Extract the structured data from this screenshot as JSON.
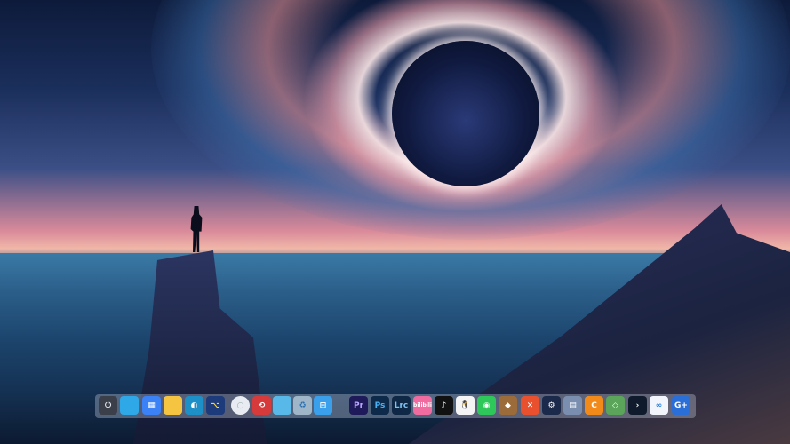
{
  "dock": {
    "items": [
      {
        "name": "power-icon",
        "label": "⏻",
        "bg": "#3a3f4a",
        "color": "#dfe3ea"
      },
      {
        "name": "monitor-icon",
        "label": "",
        "bg": "#2fa8e8"
      },
      {
        "name": "widgets-icon",
        "label": "▦",
        "bg": "#3b82f6"
      },
      {
        "name": "file-explorer-icon",
        "label": "",
        "bg": "#f5c542"
      },
      {
        "name": "edge-browser-icon",
        "label": "◐",
        "bg": "#1e90c8"
      },
      {
        "name": "script-editor-icon",
        "label": "⌥",
        "bg": "#1d3a7a",
        "color": "#f5d442"
      },
      {
        "name": "clock-icon",
        "label": "○",
        "bg": "#e8ecf2",
        "color": "#9aa"
      },
      {
        "name": "red-app-icon",
        "label": "⟲",
        "bg": "#d63a3a"
      },
      {
        "name": "notepad-icon",
        "label": "",
        "bg": "#58b8e8"
      },
      {
        "name": "recycle-bin-icon",
        "label": "♻",
        "bg": "#9fb6c8",
        "color": "#2a6fb0"
      },
      {
        "name": "windows-start-icon",
        "label": "⊞",
        "bg": "#3aa0ec"
      },
      {
        "name": "premiere-pro-icon",
        "label": "Pr",
        "bg": "#1f1a5a",
        "color": "#b9a8ff"
      },
      {
        "name": "photoshop-icon",
        "label": "Ps",
        "bg": "#0d2a4a",
        "color": "#49b2f5"
      },
      {
        "name": "lightroom-classic-icon",
        "label": "Lrc",
        "bg": "#0e2845",
        "color": "#7ec3f5"
      },
      {
        "name": "bilibili-icon",
        "label": "bilibili",
        "bg": "#f06ca0"
      },
      {
        "name": "tiktok-icon",
        "label": "♪",
        "bg": "#111"
      },
      {
        "name": "qq-icon",
        "label": "🐧",
        "bg": "#f4f4f4",
        "color": "#111"
      },
      {
        "name": "wechat-icon",
        "label": "◉",
        "bg": "#2ec75a"
      },
      {
        "name": "game-icon",
        "label": "◆",
        "bg": "#9b6b3a"
      },
      {
        "name": "xmind-icon",
        "label": "✕",
        "bg": "#e8502e"
      },
      {
        "name": "steam-icon",
        "label": "⚙",
        "bg": "#1b2a4a"
      },
      {
        "name": "file-manager-icon",
        "label": "▤",
        "bg": "#7a8fb0"
      },
      {
        "name": "orange-app-icon",
        "label": "C",
        "bg": "#f28a1a"
      },
      {
        "name": "green-diamond-icon",
        "label": "◇",
        "bg": "#5aa55a"
      },
      {
        "name": "terminal-arrow-icon",
        "label": "›",
        "bg": "#0f1b2d"
      },
      {
        "name": "baidu-netdisk-icon",
        "label": "∞",
        "bg": "#f2f6fc",
        "color": "#2a7de1"
      },
      {
        "name": "gplus-icon",
        "label": "G+",
        "bg": "#2a6ed8"
      }
    ]
  }
}
